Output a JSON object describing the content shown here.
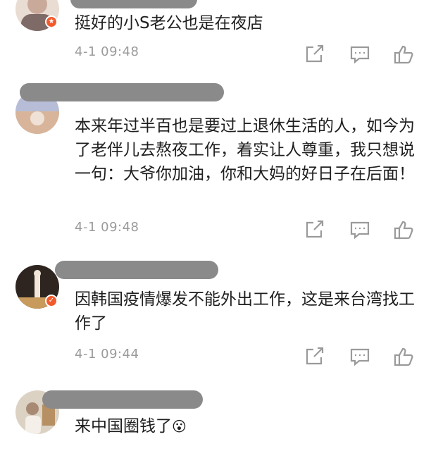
{
  "comments": [
    {
      "text": "挺好的小S老公也是在夜店",
      "time": "4-1  09:48",
      "icons": {
        "share": "share-icon",
        "reply": "reply-icon",
        "like": "thumbs-up-icon"
      }
    },
    {
      "text": "本来年过半百也是要过上退休生活的人，如今为了老伴儿去熬夜工作，着实让人尊重，我只想说一句：大爷你加油，你和大妈的好日子在后面！",
      "time": "4-1  09:48",
      "icons": {
        "share": "share-icon",
        "reply": "reply-icon",
        "like": "thumbs-up-icon"
      }
    },
    {
      "text": "因韩国疫情爆发不能外出工作，这是来台湾找工作了",
      "time": "4-1  09:44",
      "icons": {
        "share": "share-icon",
        "reply": "reply-icon",
        "like": "thumbs-up-icon"
      }
    },
    {
      "text": "来中国圈钱了",
      "emoji": "😮"
    }
  ],
  "colors": {
    "name_mask": "#8a8a8a",
    "time_text": "#9a9a9a",
    "icon_stroke": "#9a9a9a",
    "badge": "#f25a2b"
  }
}
